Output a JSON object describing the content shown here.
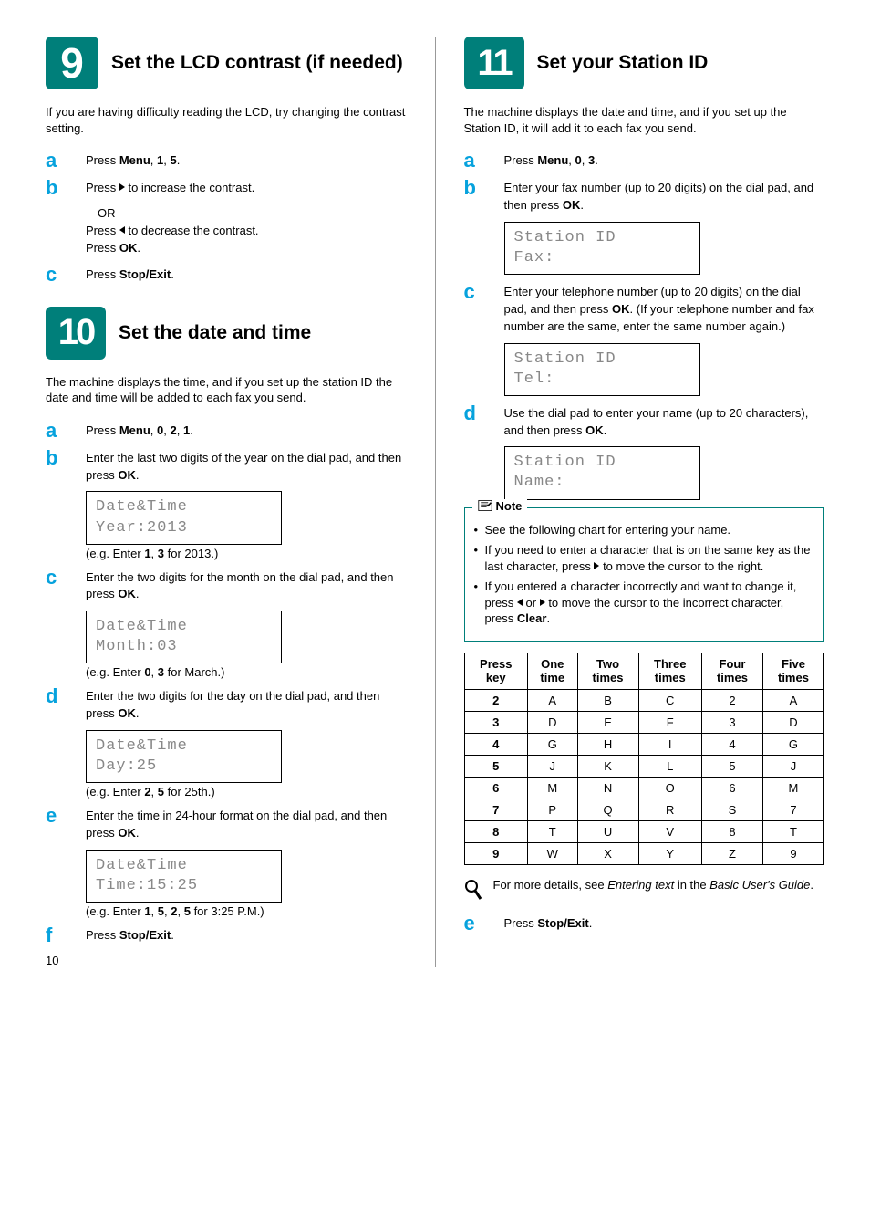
{
  "page_number": "10",
  "steps": {
    "s9": {
      "num": "9",
      "title": "Set the LCD contrast (if needed)",
      "intro": "If you are having difficulty reading the LCD, try changing the contrast setting.",
      "a_pre": "Press ",
      "a_m": "Menu",
      "a_c": ", ",
      "a_k1": "1",
      "a_c2": ", ",
      "a_k2": "5",
      "a_post": ".",
      "b_1a": "Press ",
      "b_1b": " to increase the contrast.",
      "b_or": "—OR—",
      "b_2a": "Press ",
      "b_2b": " to decrease the contrast.",
      "b_3a": "Press ",
      "b_3b": "OK",
      "b_3c": ".",
      "c_pre": "Press ",
      "c_b": "Stop/Exit",
      "c_post": "."
    },
    "s10": {
      "num": "10",
      "title": "Set the date and time",
      "intro": "The machine displays the time, and if you set up the station ID the date and time will be added to each fax you send.",
      "a_pre": "Press ",
      "a_m": "Menu",
      "a_c1": ", ",
      "a_k1": "0",
      "a_c2": ", ",
      "a_k2": "2",
      "a_c3": ", ",
      "a_k3": "1",
      "a_post": ".",
      "b_1": "Enter the last two digits of the year on the dial pad, and then press ",
      "b_ok": "OK",
      "b_post": ".",
      "b_lcd1": "Date&Time",
      "b_lcd2": "Year:2013",
      "b_eg_p1": "(e.g. Enter ",
      "b_eg_k1": "1",
      "b_eg_c1": ", ",
      "b_eg_k2": "3",
      "b_eg_p2": " for 2013.)",
      "c_1": "Enter the two digits for the month on the dial pad, and then press ",
      "c_ok": "OK",
      "c_post": ".",
      "c_lcd1": "Date&Time",
      "c_lcd2": "Month:03",
      "c_eg_p1": "(e.g. Enter ",
      "c_eg_k1": "0",
      "c_eg_c1": ", ",
      "c_eg_k2": "3",
      "c_eg_p2": " for March.)",
      "d_1": "Enter the two digits for the day on the dial pad, and then press ",
      "d_ok": "OK",
      "d_post": ".",
      "d_lcd1": "Date&Time",
      "d_lcd2": "Day:25",
      "d_eg_p1": "(e.g. Enter ",
      "d_eg_k1": "2",
      "d_eg_c1": ", ",
      "d_eg_k2": "5",
      "d_eg_p2": " for 25th.)",
      "e_1": "Enter the time in 24-hour format on the dial pad, and then press ",
      "e_ok": "OK",
      "e_post": ".",
      "e_lcd1": "Date&Time",
      "e_lcd2": "Time:15:25",
      "e_eg_p1": "(e.g. Enter ",
      "e_eg_k1": "1",
      "e_eg_c1": ", ",
      "e_eg_k2": "5",
      "e_eg_c2": ", ",
      "e_eg_k3": "2",
      "e_eg_c3": ", ",
      "e_eg_k4": "5",
      "e_eg_p2": " for 3:25 P.M.)",
      "f_pre": "Press ",
      "f_b": "Stop/Exit",
      "f_post": "."
    },
    "s11": {
      "num": "11",
      "title": "Set your Station ID",
      "intro": "The machine displays the date and time, and if you set up the Station ID, it will add it to each fax you send.",
      "a_pre": "Press ",
      "a_m": "Menu",
      "a_c1": ", ",
      "a_k1": "0",
      "a_c2": ", ",
      "a_k2": "3",
      "a_post": ".",
      "b_1": "Enter your fax number (up to 20 digits) on the dial pad, and then press ",
      "b_ok": "OK",
      "b_post": ".",
      "b_lcd1": "Station ID",
      "b_lcd2": "Fax:",
      "c_1": "Enter your telephone number (up to 20 digits) on the dial pad, and then press ",
      "c_ok": "OK",
      "c_2": ". (If your telephone number and fax number are the same, enter the same number again.)",
      "c_lcd1": "Station ID",
      "c_lcd2": "Tel:",
      "d_1": "Use the dial pad to enter your name (up to 20 characters), and then press ",
      "d_ok": "OK",
      "d_post": ".",
      "d_lcd1": "Station ID",
      "d_lcd2": "Name:",
      "note_label": "Note",
      "note1": "See the following chart for entering your name.",
      "note2a": "If you need to enter a character that is on the same key as the last character, press ",
      "note2b": " to move the cursor to the right.",
      "note3a": "If you entered a character incorrectly and want to change it, press ",
      "note3b": " or ",
      "note3c": " to move the cursor to the incorrect character, press ",
      "note3_clear": "Clear",
      "note3d": ".",
      "info1": "For more details, see ",
      "info_em": "Entering text",
      "info2": " in the ",
      "info_em2": "Basic User's Guide",
      "info3": ".",
      "e_pre": "Press ",
      "e_b": "Stop/Exit",
      "e_post": "."
    }
  },
  "char_table": {
    "headers": [
      "Press key",
      "One time",
      "Two times",
      "Three times",
      "Four times",
      "Five times"
    ],
    "rows": [
      [
        "2",
        "A",
        "B",
        "C",
        "2",
        "A"
      ],
      [
        "3",
        "D",
        "E",
        "F",
        "3",
        "D"
      ],
      [
        "4",
        "G",
        "H",
        "I",
        "4",
        "G"
      ],
      [
        "5",
        "J",
        "K",
        "L",
        "5",
        "J"
      ],
      [
        "6",
        "M",
        "N",
        "O",
        "6",
        "M"
      ],
      [
        "7",
        "P",
        "Q",
        "R",
        "S",
        "7"
      ],
      [
        "8",
        "T",
        "U",
        "V",
        "8",
        "T"
      ],
      [
        "9",
        "W",
        "X",
        "Y",
        "Z",
        "9"
      ]
    ]
  }
}
